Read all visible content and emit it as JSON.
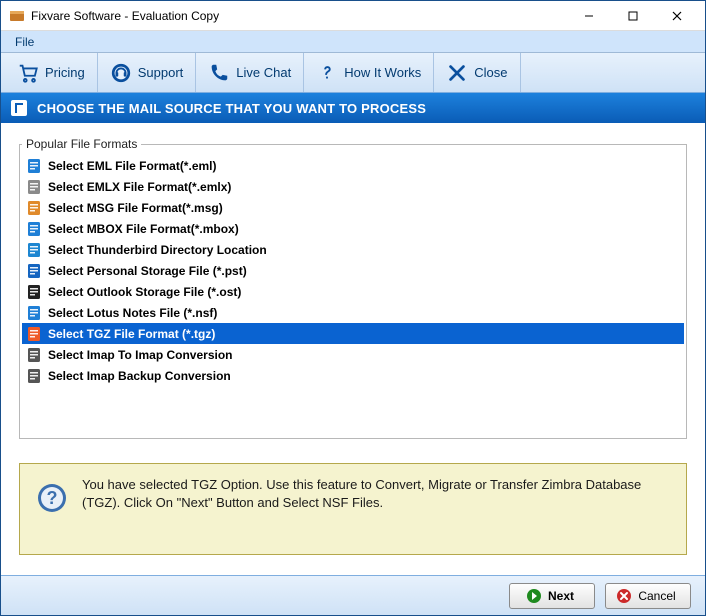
{
  "window": {
    "title": "Fixvare Software - Evaluation Copy"
  },
  "menubar": {
    "items": [
      "File"
    ]
  },
  "toolbar": {
    "items": [
      {
        "label": "Pricing",
        "icon": "cart-icon"
      },
      {
        "label": "Support",
        "icon": "headset-icon"
      },
      {
        "label": "Live Chat",
        "icon": "phone-icon"
      },
      {
        "label": "How It Works",
        "icon": "question-icon"
      },
      {
        "label": "Close",
        "icon": "close-x-icon"
      }
    ]
  },
  "banner": {
    "text": "CHOOSE THE MAIL SOURCE THAT YOU WANT TO PROCESS"
  },
  "formats": {
    "legend": "Popular File Formats",
    "selected_index": 8,
    "items": [
      {
        "label": "Select EML File Format(*.eml)",
        "icon": "file-eml-icon",
        "color": "#1f7fd6"
      },
      {
        "label": "Select EMLX File Format(*.emlx)",
        "icon": "envelope-icon",
        "color": "#8a8a8a"
      },
      {
        "label": "Select MSG File Format(*.msg)",
        "icon": "file-msg-icon",
        "color": "#e08a2b"
      },
      {
        "label": "Select MBOX File Format(*.mbox)",
        "icon": "inbox-icon",
        "color": "#1f7fd6"
      },
      {
        "label": "Select Thunderbird Directory Location",
        "icon": "thunderbird-icon",
        "color": "#1d86d1"
      },
      {
        "label": "Select Personal Storage File (*.pst)",
        "icon": "outlook-pst-icon",
        "color": "#1565c0"
      },
      {
        "label": "Select Outlook Storage File (*.ost)",
        "icon": "outlook-ost-icon",
        "color": "#222222"
      },
      {
        "label": "Select Lotus Notes File (*.nsf)",
        "icon": "lotus-notes-icon",
        "color": "#1f7fd6"
      },
      {
        "label": "Select TGZ File Format (*.tgz)",
        "icon": "tgz-icon",
        "color": "#ef5a28"
      },
      {
        "label": "Select Imap To Imap Conversion",
        "icon": "sync-icon",
        "color": "#555555"
      },
      {
        "label": "Select Imap Backup Conversion",
        "icon": "sync-icon",
        "color": "#555555"
      }
    ]
  },
  "info": {
    "text": "You have selected TGZ Option. Use this feature to Convert, Migrate or Transfer Zimbra Database (TGZ). Click On \"Next\" Button and Select NSF Files."
  },
  "footer": {
    "next": "Next",
    "cancel": "Cancel"
  }
}
